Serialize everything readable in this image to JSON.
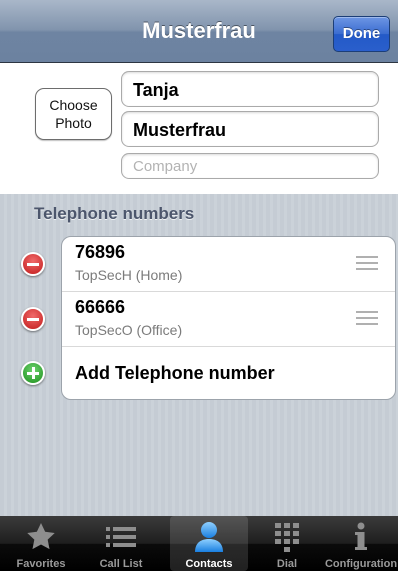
{
  "navbar": {
    "title": "Musterfrau",
    "done_label": "Done"
  },
  "header": {
    "choose_photo_line1": "Choose",
    "choose_photo_line2": "Photo",
    "first_name": "Tanja",
    "last_name": "Musterfrau",
    "company_placeholder": "Company"
  },
  "phones": {
    "section_title": "Telephone numbers",
    "items": [
      {
        "number": "76896",
        "label": "TopSecH (Home)"
      },
      {
        "number": "66666",
        "label": "TopSecO (Office)"
      }
    ],
    "add_label": "Add Telephone number"
  },
  "tabbar": {
    "tabs": [
      {
        "label": "Favorites",
        "icon": "star-icon"
      },
      {
        "label": "Call List",
        "icon": "list-icon"
      },
      {
        "label": "Contacts",
        "icon": "person-icon",
        "active": true
      },
      {
        "label": "Dial",
        "icon": "keypad-icon"
      },
      {
        "label": "Configuration",
        "icon": "info-icon"
      }
    ]
  },
  "colors": {
    "navbar": "#7489a6",
    "done_button": "#2f63cd",
    "delete_button": "#c11b1b",
    "add_button": "#1c8f1c",
    "section_header": "#4c566c",
    "grouped_background": "#c5ccd4"
  }
}
